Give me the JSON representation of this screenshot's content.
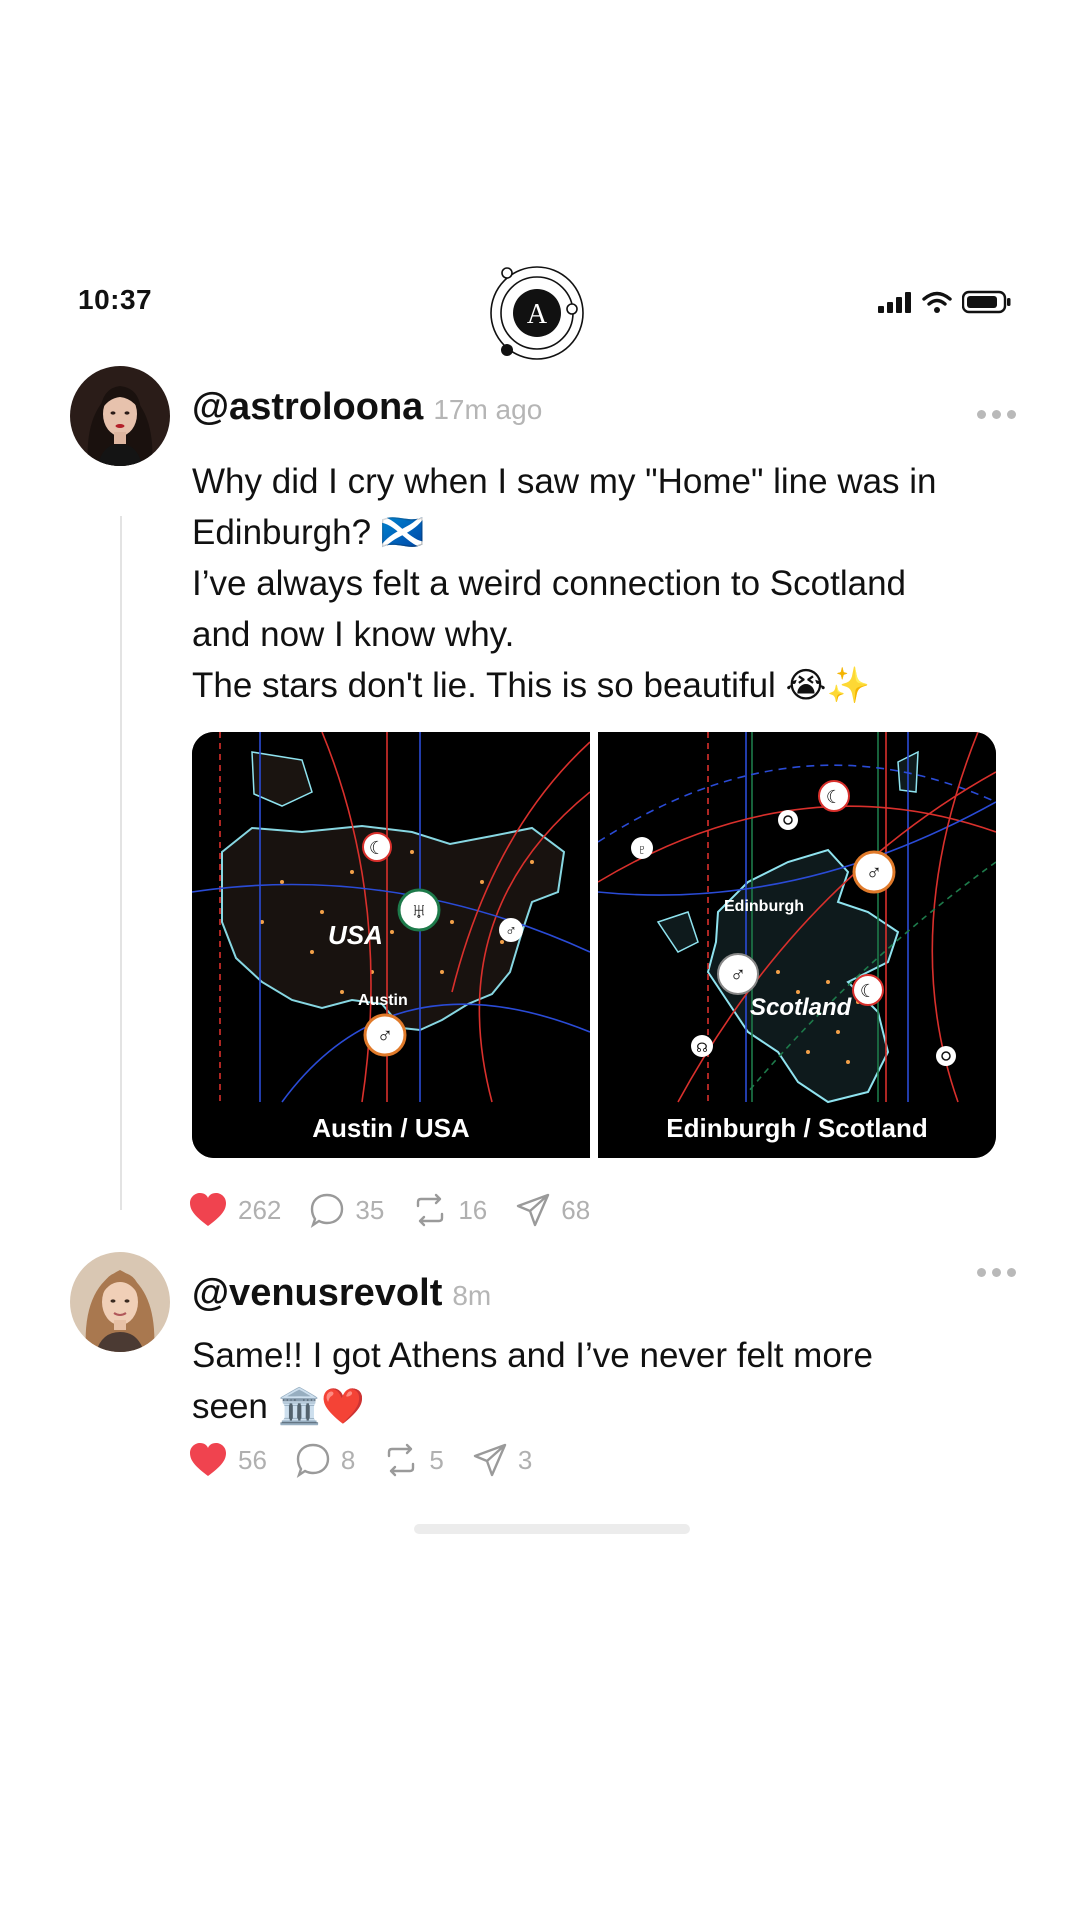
{
  "status_bar": {
    "time": "10:37",
    "logo_letter": "A",
    "icons": [
      "signal-icon",
      "wifi-icon",
      "battery-icon"
    ]
  },
  "posts": [
    {
      "handle": "@astroloona",
      "time_ago": "17m ago",
      "text_lines": [
        "Why did I cry when I saw my \"Home\" line was in",
        "Edinburgh? 🏴󠁧󠁢󠁳󠁣󠁴󠁿",
        "I’ve always felt a weird connection to Scotland",
        "and now I know why.",
        "The stars don't lie. This is so beautiful 😭✨"
      ],
      "media": [
        {
          "caption": "Austin / USA",
          "region_label": "USA",
          "city_label": "Austin"
        },
        {
          "caption": "Edinburgh / Scotland",
          "region_label": "Scotland",
          "city_label": "Edinburgh"
        }
      ],
      "stats": {
        "likes": "262",
        "comments": "35",
        "reposts": "16",
        "shares": "68"
      }
    },
    {
      "handle": "@venusrevolt",
      "time_ago": "8m",
      "text_lines": [
        "Same!! I got Athens and I’ve never felt more",
        "seen 🏛️❤️"
      ],
      "stats": {
        "likes": "56",
        "comments": "8",
        "reposts": "5",
        "shares": "3"
      }
    }
  ],
  "colors": {
    "like_red": "#f0434f",
    "muted_gray": "#b0b0b0",
    "map_background": "#000000",
    "planet_line_red": "#d9302c",
    "planet_line_blue": "#2a4bd6",
    "city_glow": "#f3a048",
    "coast_glow": "#8fe3ef"
  }
}
